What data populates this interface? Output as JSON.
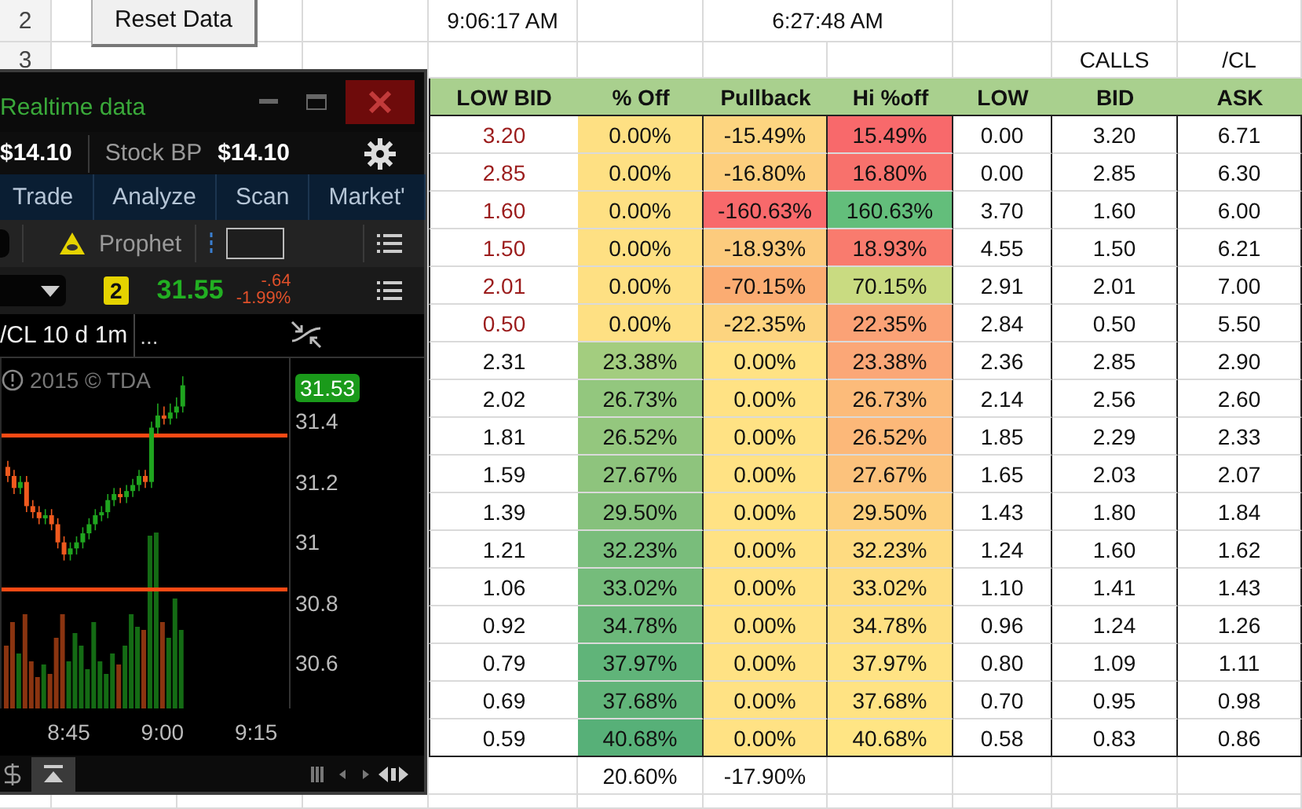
{
  "sheet": {
    "row_numbers": [
      "2",
      "3"
    ],
    "reset_button": "Reset Data",
    "time_1": "9:06:17 AM",
    "time_2": "6:27:48 AM",
    "group_labels": [
      "CALLS",
      "/CL"
    ]
  },
  "table": {
    "columns": [
      "LOW BID",
      "% Off",
      "Pullback",
      "Hi %off",
      "LOW",
      "BID",
      "ASK"
    ],
    "rows": [
      {
        "flagged": true,
        "cells": [
          {
            "text": "3.20"
          },
          {
            "text": "0.00%",
            "color": "#fee083"
          },
          {
            "text": "-15.49%",
            "color": "#fdd580"
          },
          {
            "text": "15.49%",
            "color": "#f8696b"
          },
          {
            "text": "0.00"
          },
          {
            "text": "3.20"
          },
          {
            "text": "6.71"
          }
        ]
      },
      {
        "flagged": true,
        "cells": [
          {
            "text": "2.85"
          },
          {
            "text": "0.00%",
            "color": "#fee083"
          },
          {
            "text": "-16.80%",
            "color": "#fdcf7e"
          },
          {
            "text": "16.80%",
            "color": "#f8716c"
          },
          {
            "text": "0.00"
          },
          {
            "text": "2.85"
          },
          {
            "text": "6.30"
          }
        ]
      },
      {
        "flagged": true,
        "cells": [
          {
            "text": "1.60"
          },
          {
            "text": "0.00%",
            "color": "#fee083"
          },
          {
            "text": "-160.63%",
            "color": "#f8696b"
          },
          {
            "text": "160.63%",
            "color": "#63be7b"
          },
          {
            "text": "3.70"
          },
          {
            "text": "1.60"
          },
          {
            "text": "6.00"
          }
        ]
      },
      {
        "flagged": true,
        "cells": [
          {
            "text": "1.50"
          },
          {
            "text": "0.00%",
            "color": "#fee083"
          },
          {
            "text": "-18.93%",
            "color": "#fccb7d"
          },
          {
            "text": "18.93%",
            "color": "#f97b6e"
          },
          {
            "text": "4.55"
          },
          {
            "text": "1.50"
          },
          {
            "text": "6.21"
          }
        ]
      },
      {
        "flagged": true,
        "cells": [
          {
            "text": "2.01"
          },
          {
            "text": "0.00%",
            "color": "#fee083"
          },
          {
            "text": "-70.15%",
            "color": "#fbac72"
          },
          {
            "text": "70.15%",
            "color": "#c9db81"
          },
          {
            "text": "2.91"
          },
          {
            "text": "2.01"
          },
          {
            "text": "7.00"
          }
        ]
      },
      {
        "flagged": true,
        "cells": [
          {
            "text": "0.50"
          },
          {
            "text": "0.00%",
            "color": "#fee083"
          },
          {
            "text": "-22.35%",
            "color": "#fdd47f"
          },
          {
            "text": "22.35%",
            "color": "#fba276"
          },
          {
            "text": "2.84"
          },
          {
            "text": "0.50"
          },
          {
            "text": "5.50"
          }
        ]
      },
      {
        "flagged": false,
        "cells": [
          {
            "text": "2.31"
          },
          {
            "text": "23.38%",
            "color": "#a3cd7f"
          },
          {
            "text": "0.00%",
            "color": "#ffe284"
          },
          {
            "text": "23.38%",
            "color": "#fba777"
          },
          {
            "text": "2.36"
          },
          {
            "text": "2.85"
          },
          {
            "text": "2.90"
          }
        ]
      },
      {
        "flagged": false,
        "cells": [
          {
            "text": "2.02"
          },
          {
            "text": "26.73%",
            "color": "#93c77e"
          },
          {
            "text": "0.00%",
            "color": "#ffe284"
          },
          {
            "text": "26.73%",
            "color": "#fcbb7a"
          },
          {
            "text": "2.14"
          },
          {
            "text": "2.56"
          },
          {
            "text": "2.60"
          }
        ]
      },
      {
        "flagged": false,
        "cells": [
          {
            "text": "1.81"
          },
          {
            "text": "26.52%",
            "color": "#94c77e"
          },
          {
            "text": "0.00%",
            "color": "#ffe284"
          },
          {
            "text": "26.52%",
            "color": "#fcb879"
          },
          {
            "text": "1.85"
          },
          {
            "text": "2.29"
          },
          {
            "text": "2.33"
          }
        ]
      },
      {
        "flagged": false,
        "cells": [
          {
            "text": "1.59"
          },
          {
            "text": "27.67%",
            "color": "#8ec47d"
          },
          {
            "text": "0.00%",
            "color": "#ffe284"
          },
          {
            "text": "27.67%",
            "color": "#fcc27c"
          },
          {
            "text": "1.65"
          },
          {
            "text": "2.03"
          },
          {
            "text": "2.07"
          }
        ]
      },
      {
        "flagged": false,
        "cells": [
          {
            "text": "1.39"
          },
          {
            "text": "29.50%",
            "color": "#86c17c"
          },
          {
            "text": "0.00%",
            "color": "#ffe284"
          },
          {
            "text": "29.50%",
            "color": "#fdd07e"
          },
          {
            "text": "1.43"
          },
          {
            "text": "1.80"
          },
          {
            "text": "1.84"
          }
        ]
      },
      {
        "flagged": false,
        "cells": [
          {
            "text": "1.21"
          },
          {
            "text": "32.23%",
            "color": "#79bd7b"
          },
          {
            "text": "0.00%",
            "color": "#ffe284"
          },
          {
            "text": "32.23%",
            "color": "#fedb81"
          },
          {
            "text": "1.24"
          },
          {
            "text": "1.60"
          },
          {
            "text": "1.62"
          }
        ]
      },
      {
        "flagged": false,
        "cells": [
          {
            "text": "1.06"
          },
          {
            "text": "33.02%",
            "color": "#75bc7b"
          },
          {
            "text": "0.00%",
            "color": "#ffe284"
          },
          {
            "text": "33.02%",
            "color": "#fede82"
          },
          {
            "text": "1.10"
          },
          {
            "text": "1.41"
          },
          {
            "text": "1.43"
          }
        ]
      },
      {
        "flagged": false,
        "cells": [
          {
            "text": "0.92"
          },
          {
            "text": "34.78%",
            "color": "#6cb87a"
          },
          {
            "text": "0.00%",
            "color": "#ffe284"
          },
          {
            "text": "34.78%",
            "color": "#fee082"
          },
          {
            "text": "0.96"
          },
          {
            "text": "1.24"
          },
          {
            "text": "1.26"
          }
        ]
      },
      {
        "flagged": false,
        "cells": [
          {
            "text": "0.79"
          },
          {
            "text": "37.97%",
            "color": "#60b479"
          },
          {
            "text": "0.00%",
            "color": "#ffe284"
          },
          {
            "text": "37.97%",
            "color": "#ffe384"
          },
          {
            "text": "0.80"
          },
          {
            "text": "1.09"
          },
          {
            "text": "1.11"
          }
        ]
      },
      {
        "flagged": false,
        "cells": [
          {
            "text": "0.69"
          },
          {
            "text": "37.68%",
            "color": "#61b479"
          },
          {
            "text": "0.00%",
            "color": "#ffe284"
          },
          {
            "text": "37.68%",
            "color": "#ffe383"
          },
          {
            "text": "0.70"
          },
          {
            "text": "0.95"
          },
          {
            "text": "0.98"
          }
        ]
      },
      {
        "flagged": false,
        "cells": [
          {
            "text": "0.59"
          },
          {
            "text": "40.68%",
            "color": "#57b078"
          },
          {
            "text": "0.00%",
            "color": "#ffe284"
          },
          {
            "text": "40.68%",
            "color": "#ffe584"
          },
          {
            "text": "0.58"
          },
          {
            "text": "0.83"
          },
          {
            "text": "0.86"
          }
        ]
      }
    ],
    "totals": {
      "pct_off": "20.60%",
      "pullback": "-17.90%"
    }
  },
  "platform": {
    "title": "Realtime data",
    "buying_power": "$14.10",
    "stock_bp_label": "Stock BP",
    "stock_bp": "$14.10",
    "tabs": [
      {
        "label": "Trade",
        "selected": false
      },
      {
        "label": "Analyze",
        "selected": false
      },
      {
        "label": "Scan",
        "selected": false
      },
      {
        "label": "Market'",
        "selected": false
      }
    ],
    "study": "Prophet",
    "quote": {
      "badge": "2",
      "last": "31.55",
      "change": "-.64",
      "change_pct": "-1.99%"
    },
    "chart": {
      "symbol": "/CL 10 d 1m",
      "extra": "...",
      "copyright": "2015 © TDA",
      "last_price": "31.53",
      "chart_data": {
        "type": "candlestick",
        "x": [
          515,
          516,
          517,
          518,
          519,
          520,
          521,
          522,
          523,
          524,
          525,
          526,
          527,
          528,
          529,
          530,
          531,
          532,
          533,
          534,
          535,
          536,
          537,
          538,
          539,
          540,
          541,
          542,
          543
        ],
        "ohlc": [
          [
            31.25,
            31.27,
            31.2,
            31.22
          ],
          [
            31.22,
            31.24,
            31.16,
            31.18
          ],
          [
            31.18,
            31.22,
            31.16,
            31.2
          ],
          [
            31.2,
            31.22,
            31.1,
            31.12
          ],
          [
            31.12,
            31.14,
            31.08,
            31.1
          ],
          [
            31.1,
            31.12,
            31.06,
            31.08
          ],
          [
            31.08,
            31.11,
            31.06,
            31.09
          ],
          [
            31.09,
            31.11,
            31.04,
            31.06
          ],
          [
            31.06,
            31.08,
            30.98,
            31.0
          ],
          [
            31.0,
            31.02,
            30.94,
            30.96
          ],
          [
            30.96,
            31.0,
            30.94,
            30.98
          ],
          [
            30.98,
            31.02,
            30.96,
            31.0
          ],
          [
            31.0,
            31.05,
            30.98,
            31.03
          ],
          [
            31.03,
            31.08,
            31.01,
            31.06
          ],
          [
            31.06,
            31.11,
            31.04,
            31.09
          ],
          [
            31.09,
            31.12,
            31.07,
            31.1
          ],
          [
            31.1,
            31.16,
            31.08,
            31.14
          ],
          [
            31.14,
            31.18,
            31.12,
            31.16
          ],
          [
            31.16,
            31.18,
            31.13,
            31.15
          ],
          [
            31.15,
            31.19,
            31.13,
            31.17
          ],
          [
            31.17,
            31.21,
            31.15,
            31.19
          ],
          [
            31.19,
            31.24,
            31.17,
            31.22
          ],
          [
            31.22,
            31.24,
            31.18,
            31.2
          ],
          [
            31.2,
            31.4,
            31.18,
            31.38
          ],
          [
            31.38,
            31.46,
            31.36,
            31.42
          ],
          [
            31.42,
            31.45,
            31.39,
            31.41
          ],
          [
            31.41,
            31.46,
            31.39,
            31.43
          ],
          [
            31.43,
            31.48,
            31.41,
            31.45
          ],
          [
            31.45,
            31.55,
            31.43,
            31.52
          ]
        ],
        "xlim": [
          514,
          560
        ],
        "ylim": [
          30.45,
          31.61
        ],
        "yticks": [
          {
            "value": 31.4,
            "label": "31.4"
          },
          {
            "value": 31.2,
            "label": "31.2"
          },
          {
            "value": 31,
            "label": "31"
          },
          {
            "value": 30.8,
            "label": "30.8"
          },
          {
            "value": 30.6,
            "label": "30.6"
          }
        ],
        "xticks": [
          {
            "value": 525,
            "label": "8:45"
          },
          {
            "value": 540,
            "label": "9:00"
          },
          {
            "value": 555,
            "label": "9:15"
          }
        ]
      }
    }
  }
}
